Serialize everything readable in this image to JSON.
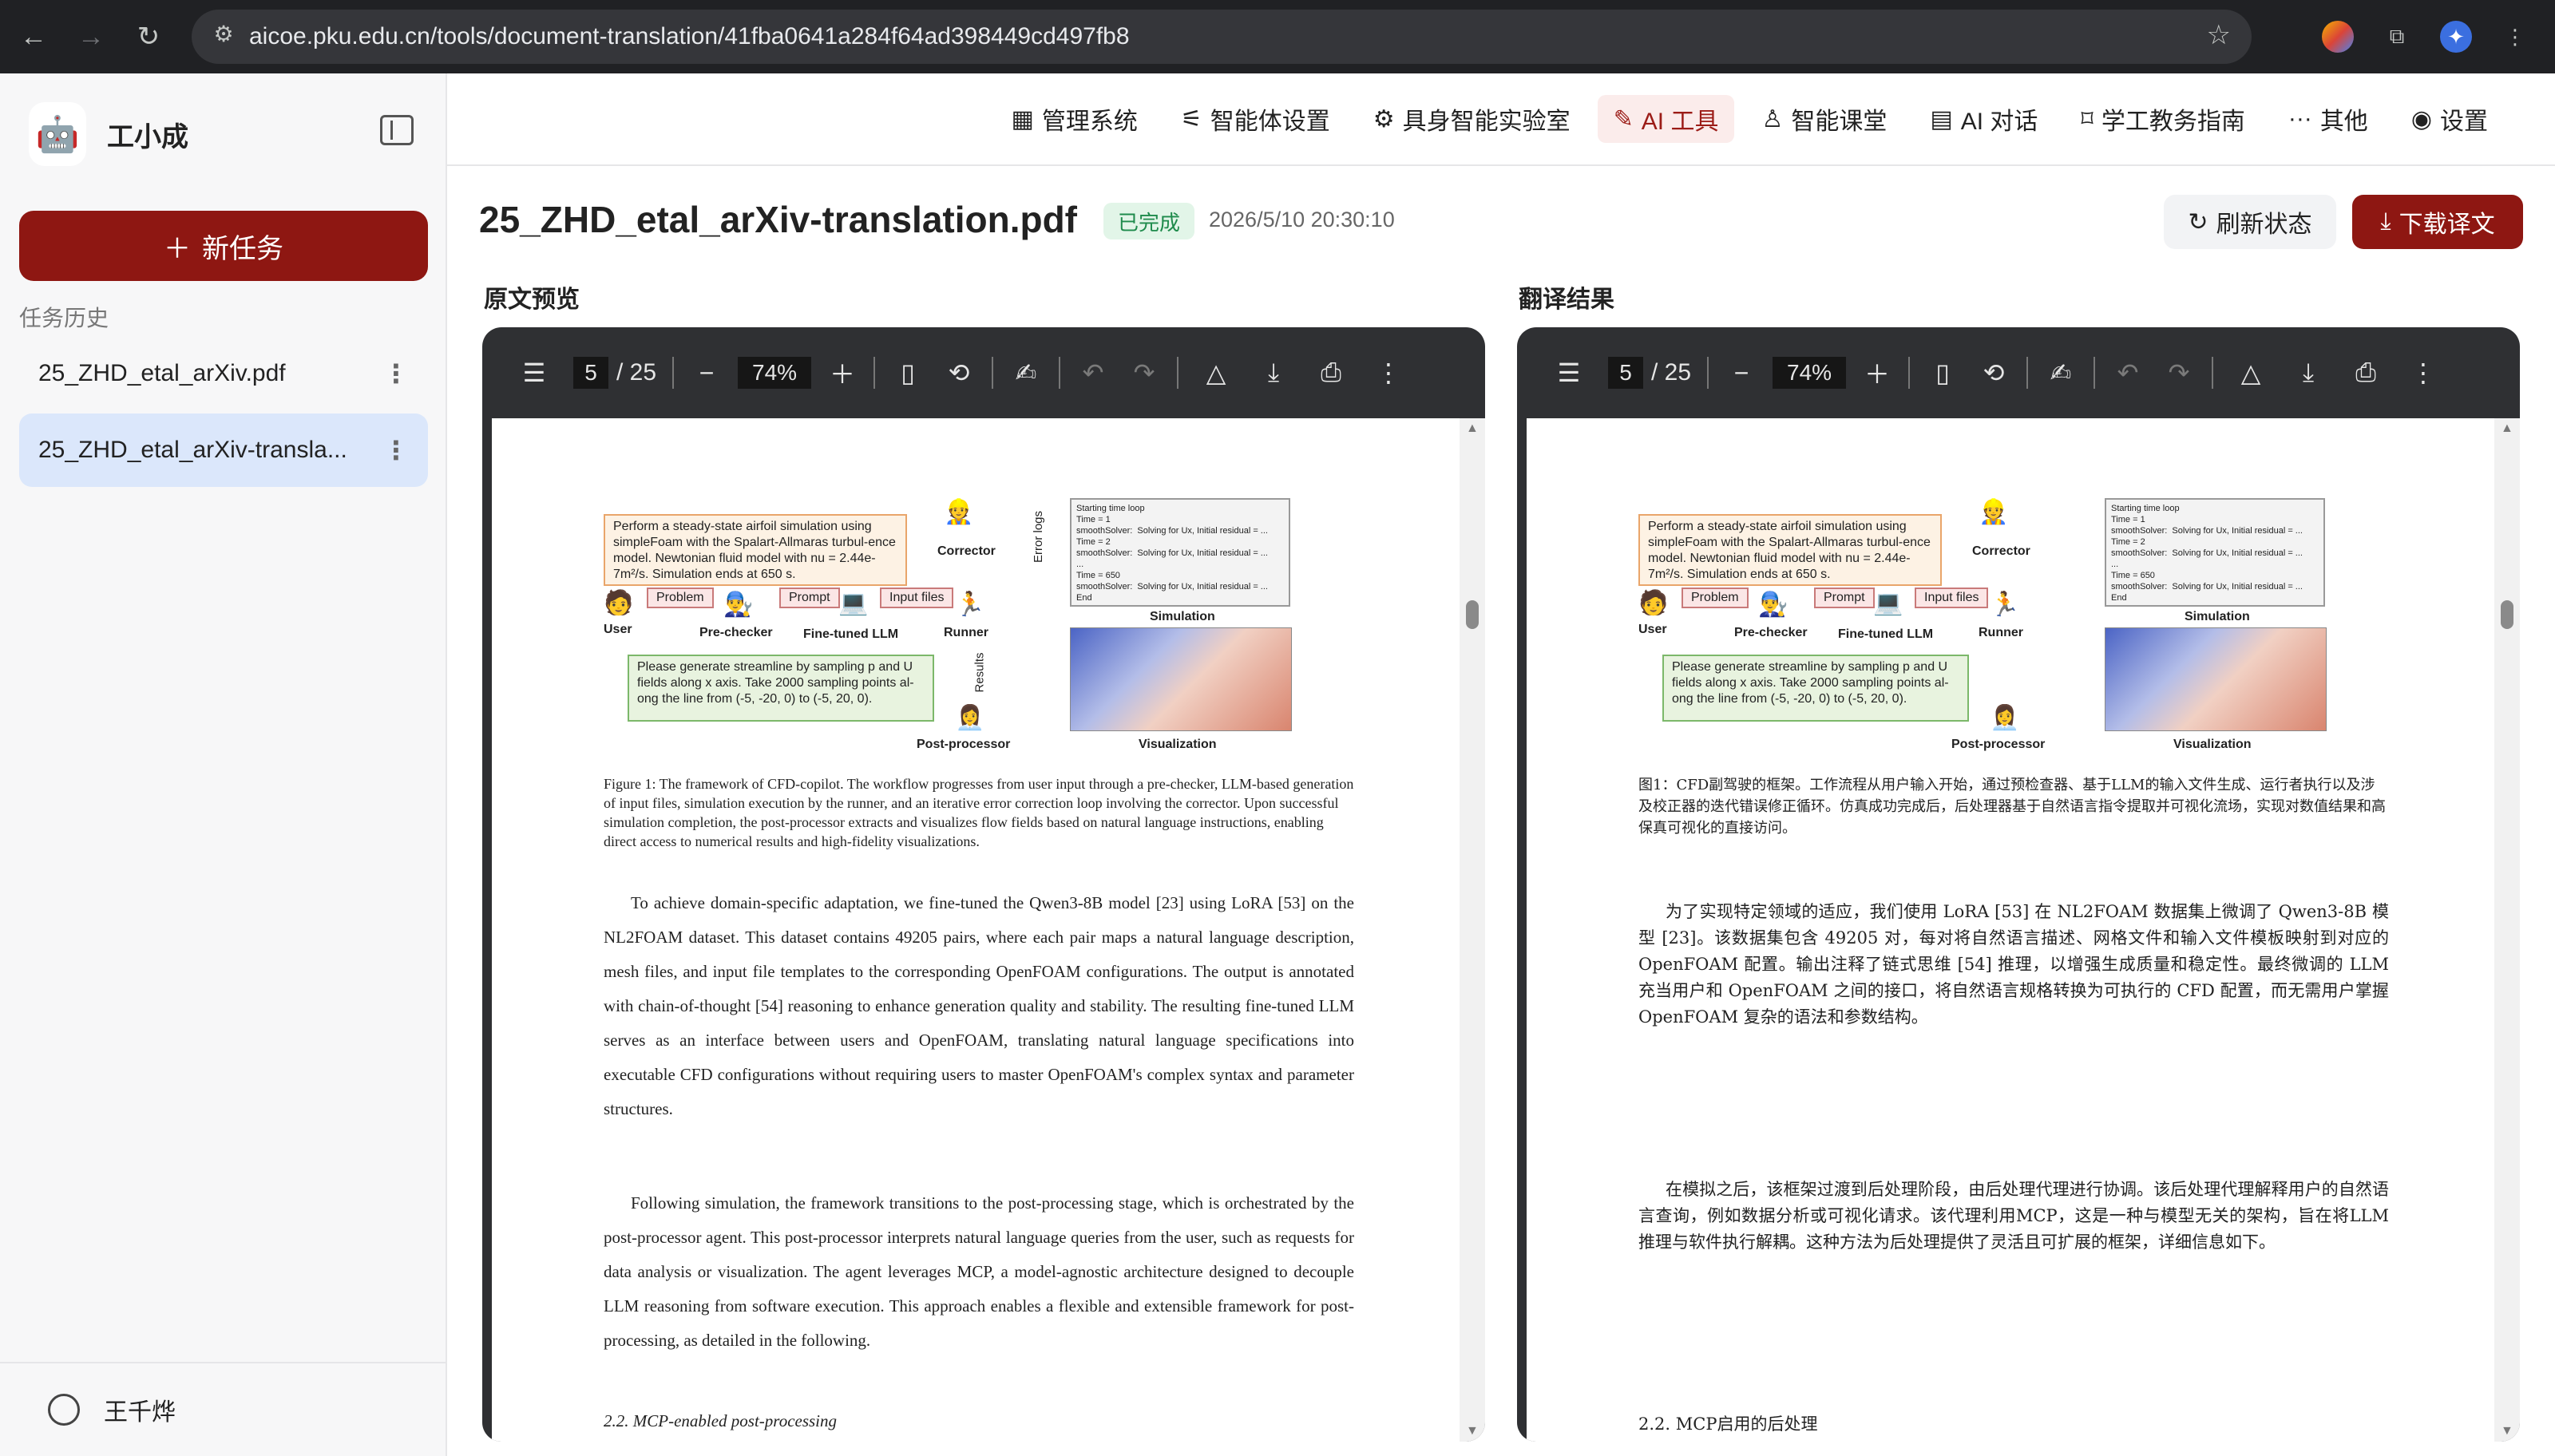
{
  "browser": {
    "url": "aicoe.pku.edu.cn/tools/document-translation/41fba0641a284f64ad398449cd497fb8"
  },
  "sidebar": {
    "brand": "工小成",
    "new_task": "新任务",
    "history_label": "任务历史",
    "items": [
      {
        "label": "25_ZHD_etal_arXiv.pdf"
      },
      {
        "label": "25_ZHD_etal_arXiv-transla..."
      }
    ],
    "user": "王千烨"
  },
  "nav": [
    {
      "label": "管理系统",
      "icon": "grid-icon"
    },
    {
      "label": "智能体设置",
      "icon": "sliders-icon"
    },
    {
      "label": "具身智能实验室",
      "icon": "brain-icon"
    },
    {
      "label": "AI 工具",
      "icon": "tools-icon",
      "active": true
    },
    {
      "label": "智能课堂",
      "icon": "teacher-icon"
    },
    {
      "label": "AI 对话",
      "icon": "chat-icon"
    },
    {
      "label": "学工教务指南",
      "icon": "bookmark-icon"
    },
    {
      "label": "其他",
      "icon": "more-icon"
    },
    {
      "label": "设置",
      "icon": "user-icon"
    }
  ],
  "document": {
    "title": "25_ZHD_etal_arXiv-translation.pdf",
    "status": "已完成",
    "timestamp": "2026/5/10 20:30:10",
    "refresh": "刷新状态",
    "download": "下载译文"
  },
  "panels": {
    "original": "原文预览",
    "translated": "翻译结果"
  },
  "viewer": {
    "page": "5",
    "total": "/ 25",
    "zoom": "74%"
  },
  "figure": {
    "prompt": "Perform a steady-state airfoil simulation using simpleFoam with the Spalart-Allmaras turbul-ence model. Newtonian fluid model with nu = 2.44e-7m²/s. Simulation ends at 650 s.",
    "post_prompt": "Please generate streamline by sampling p and U fields along x axis. Take 2000 sampling points al-ong the line from (-5, -20, 0) to (-5, 20, 0).",
    "log": "Starting time loop\nTime = 1\nsmoothSolver:  Solving for Ux, Initial residual = ...\nTime = 2\nsmoothSolver:  Solving for Ux, Initial residual = ...\n...\nTime = 650\nsmoothSolver:  Solving for Ux, Initial residual = ...\nEnd",
    "labels": {
      "user": "User",
      "prechecker": "Pre-checker",
      "llm": "Fine-tuned LLM",
      "runner": "Runner",
      "corrector": "Corrector",
      "simulation": "Simulation",
      "visualization": "Visualization",
      "postproc": "Post-processor",
      "problem": "Problem",
      "prompt": "Prompt",
      "inputfiles": "Input files",
      "errorlogs": "Error logs",
      "results": "Results"
    }
  },
  "original": {
    "caption": "Figure 1: The framework of CFD-copilot. The workflow progresses from user input through a pre-checker, LLM-based generation of input files, simulation execution by the runner, and an iterative error correction loop involving the corrector. Upon successful simulation completion, the post-processor extracts and visualizes flow fields based on natural language instructions, enabling direct access to numerical results and high-fidelity visualizations.",
    "para1": "To achieve domain-specific adaptation, we fine-tuned the Qwen3-8B model [23] using LoRA [53] on the NL2FOAM dataset. This dataset contains 49205 pairs, where each pair maps a natural language description, mesh files, and input file templates to the corresponding OpenFOAM configurations. The output is annotated with chain-of-thought [54] reasoning to enhance generation quality and stability. The resulting fine-tuned LLM serves as an interface between users and OpenFOAM, translating natural language specifications into executable CFD configurations without requiring users to master OpenFOAM's complex syntax and parameter structures.",
    "para2": "Following simulation, the framework transitions to the post-processing stage, which is orchestrated by the post-processor agent. This post-processor interprets natural language queries from the user, such as requests for data analysis or visualization. The agent leverages MCP, a model-agnostic architecture designed to decouple LLM reasoning from software execution. This approach enables a flexible and extensible framework for post-processing, as detailed in the following.",
    "section": "2.2.  MCP-enabled post-processing"
  },
  "translated": {
    "caption": "图1：CFD副驾驶的框架。工作流程从用户输入开始，通过预检查器、基于LLM的输入文件生成、运行者执行以及涉及校正器的迭代错误修正循环。仿真成功完成后，后处理器基于自然语言指令提取并可视化流场，实现对数值结果和高保真可视化的直接访问。",
    "para1": "为了实现特定领域的适应，我们使用 LoRA [53] 在 NL2FOAM 数据集上微调了 Qwen3-8B 模型 [23]。该数据集包含 49205 对，每对将自然语言描述、网格文件和输入文件模板映射到对应的 OpenFOAM 配置。输出注释了链式思维 [54] 推理，以增强生成质量和稳定性。最终微调的 LLM 充当用户和 OpenFOAM 之间的接口，将自然语言规格转换为可执行的 CFD 配置，而无需用户掌握 OpenFOAM 复杂的语法和参数结构。",
    "para2": "在模拟之后，该框架过渡到后处理阶段，由后处理代理进行协调。该后处理代理解释用户的自然语言查询，例如数据分析或可视化请求。该代理利用MCP，这是一种与模型无关的架构，旨在将LLM推理与软件执行解耦。这种方法为后处理提供了灵活且可扩展的框架，详细信息如下。",
    "section": "2.2. MCP启用的后处理"
  }
}
